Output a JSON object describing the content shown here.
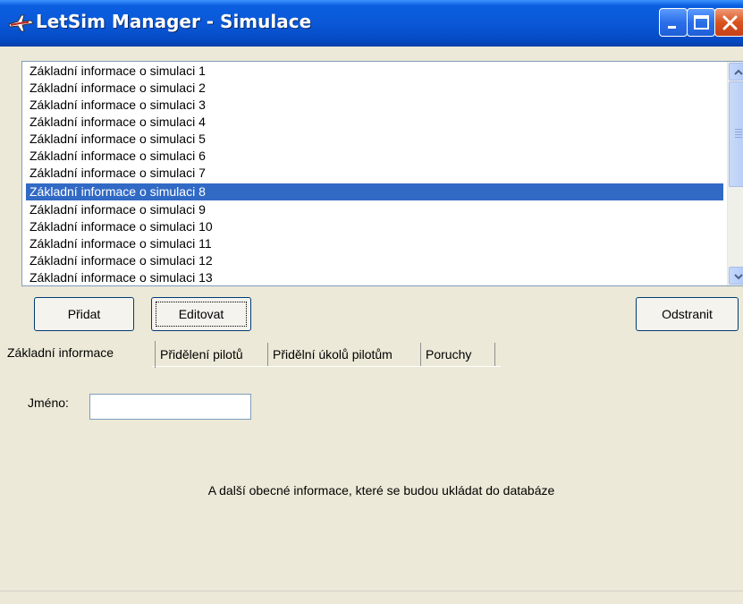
{
  "window": {
    "title": "LetSim Manager - Simulace",
    "icon": "airplane-icon",
    "controls": [
      "minimize-icon",
      "maximize-icon",
      "close-icon"
    ],
    "title_color": "#0a58d8"
  },
  "simulations": {
    "items": [
      "Základní informace o simulaci 1",
      "Základní informace o simulaci 2",
      "Základní informace o simulaci 3",
      "Základní informace o simulaci 4",
      "Základní informace o simulaci 5",
      "Základní informace o simulaci 6",
      "Základní informace o simulaci 7",
      "Základní informace o simulaci 8",
      "Základní informace o simulaci 9",
      "Základní informace o simulaci 10",
      "Základní informace o simulaci 11",
      "Základní informace o simulaci 12",
      "Základní informace o simulaci 13"
    ],
    "selected_item": "Základní informace o simulaci 8",
    "selection_color": "#316ac5"
  },
  "buttons": {
    "add_label": "Přidat",
    "edit_label": "Editovat",
    "remove_label": "Odstranit"
  },
  "tabs": [
    {
      "label": "Základní informace",
      "active": true
    },
    {
      "label": "Přidělení pilotů",
      "active": false
    },
    {
      "label": "Přidělní úkolů pilotům",
      "active": false
    },
    {
      "label": "Poruchy",
      "active": false
    }
  ],
  "basic_info": {
    "name_label": "Jméno:",
    "name_value": "",
    "description": "A další obecné informace, které se budou ukládat do databáze"
  }
}
